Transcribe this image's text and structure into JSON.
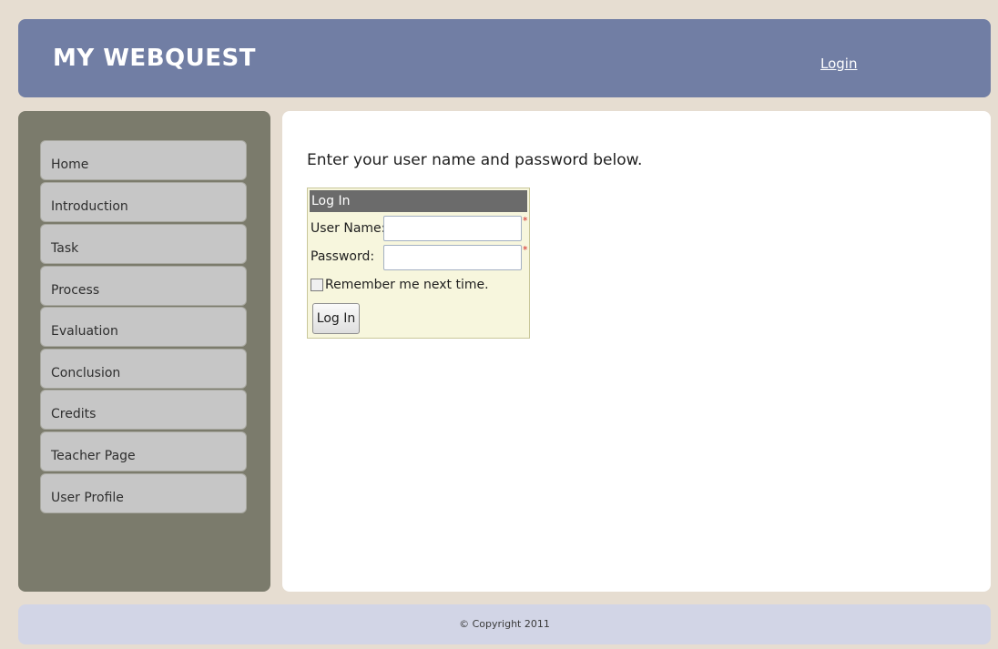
{
  "header": {
    "title": "MY WEBQUEST",
    "login_link": "Login"
  },
  "sidebar": {
    "items": [
      {
        "label": "Home"
      },
      {
        "label": "Introduction"
      },
      {
        "label": "Task"
      },
      {
        "label": "Process"
      },
      {
        "label": "Evaluation"
      },
      {
        "label": "Conclusion"
      },
      {
        "label": "Credits"
      },
      {
        "label": "Teacher Page"
      },
      {
        "label": "User Profile"
      }
    ]
  },
  "main": {
    "intro": "Enter your user name and password below.",
    "login_box": {
      "title": "Log In",
      "username_label": "User Name:",
      "username_value": "",
      "password_label": "Password:",
      "password_value": "",
      "required_mark": "*",
      "remember_label": "Remember me next time.",
      "remember_checked": false,
      "submit_label": "Log In"
    }
  },
  "footer": {
    "copyright": "© Copyright 2011"
  },
  "colors": {
    "page_background": "#e6ddd1",
    "header_background": "#717ea4",
    "sidebar_background": "#7b7b6c",
    "nav_item_background": "#c6c6c6",
    "login_box_background": "#f7f6dd",
    "login_box_title_background": "#6b6b6b",
    "required_star": "#d52222",
    "footer_background": "#d2d5e6"
  }
}
